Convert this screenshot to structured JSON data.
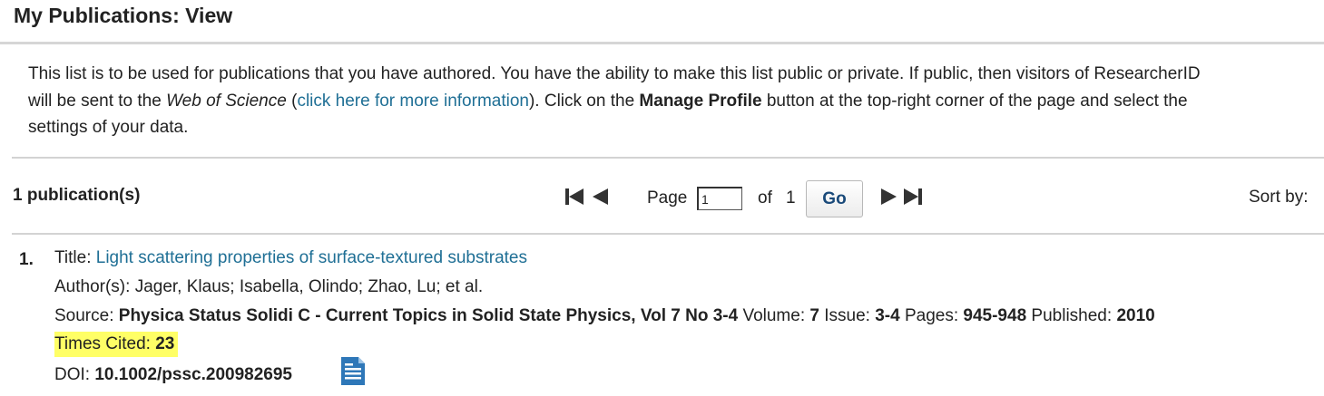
{
  "page_title": "My Publications: View",
  "intro": {
    "line1": "This list is to be used for publications that you have authored. You have the ability to make this list public or private. If public, then visitors of ResearcherID",
    "line2_a": "will be sent to the ",
    "line2_wos": "Web of Science",
    "line2_b": " (",
    "line2_link": "click here for more information",
    "line2_c": "). Click on the ",
    "line2_manage": "Manage Profile",
    "line2_d": " button at the top-right corner of the page and select the",
    "line3": "settings of your data."
  },
  "pagination": {
    "count_label": "1 publication(s)",
    "page_label": "Page",
    "page_value": "1",
    "of_label": "of",
    "total_pages": "1",
    "go_label": "Go",
    "sort_label": "Sort by:"
  },
  "publication": {
    "number": "1.",
    "title_label": "Title: ",
    "title": "Light scattering properties of surface-textured substrates",
    "authors_label": "Author(s): ",
    "authors": "Jager, Klaus; Isabella, Olindo; Zhao, Lu; et al.",
    "source_label": "Source: ",
    "source": "Physica Status Solidi C - Current Topics in Solid State Physics, Vol 7 No 3-4",
    "volume_label": " Volume: ",
    "volume": "7",
    "issue_label": " Issue: ",
    "issue": "3-4",
    "pages_label": " Pages: ",
    "pages": "945-948",
    "published_label": " Published: ",
    "published": "2010",
    "times_cited_label": "Times Cited: ",
    "times_cited": "23",
    "doi_label": "DOI: ",
    "doi": "10.1002/pssc.200982695"
  },
  "icons": {
    "first_page": "first-page-icon",
    "prev_page": "previous-page-icon",
    "next_page": "next-page-icon",
    "last_page": "last-page-icon",
    "full_text": "document-icon"
  },
  "colors": {
    "link": "#1f6f95",
    "highlight": "#ffff66",
    "doc_icon": "#2e77b8"
  }
}
